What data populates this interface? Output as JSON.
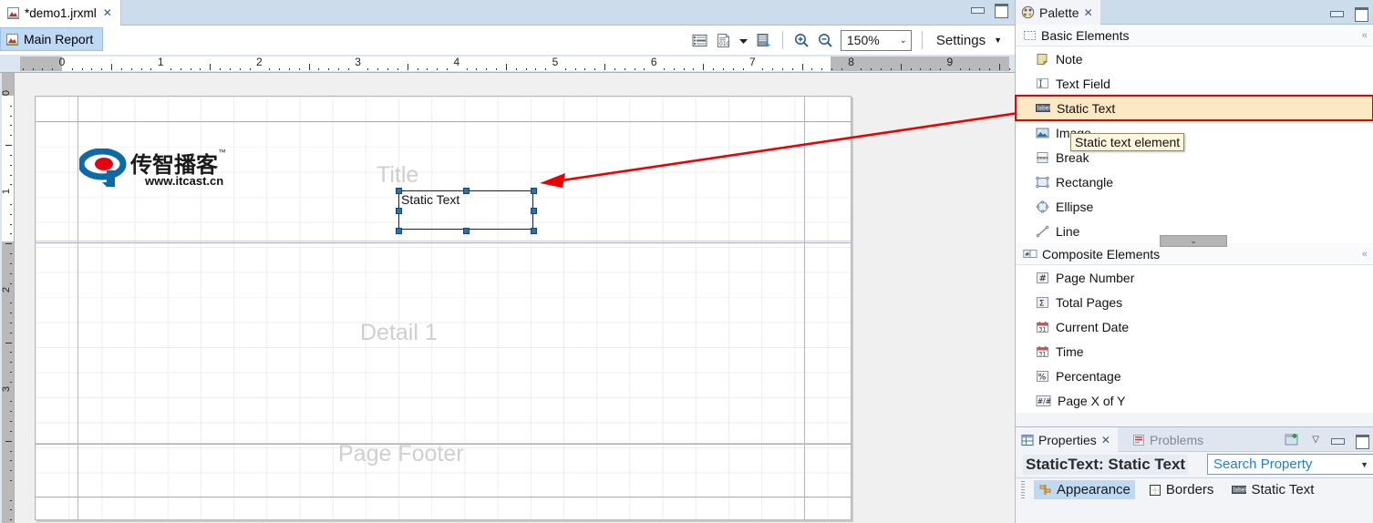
{
  "editor": {
    "tab": {
      "title": "*demo1.jrxml",
      "close": "✕",
      "icon": "jrxml-file-icon"
    },
    "window_buttons": {
      "minimize": "minimize-icon",
      "maximize": "maximize-icon"
    },
    "main_report_tab": "Main Report",
    "toolbar": {
      "icons": [
        "dataset-icon",
        "report-data-icon",
        "dropdown-arrow-icon",
        "preview-icon"
      ],
      "zoom_in": "zoom-in-icon",
      "zoom_out": "zoom-out-icon",
      "zoom_value": "150%",
      "zoom_caret": "⌄",
      "settings_label": "Settings",
      "settings_caret": "▼"
    },
    "ruler": {
      "h_numbers": [
        "0",
        "1",
        "2",
        "3",
        "4",
        "5",
        "6",
        "7",
        "8",
        "9"
      ],
      "v_numbers": [
        "0",
        "1",
        "2",
        "3"
      ]
    },
    "canvas": {
      "bands": [
        "Title",
        "Detail 1",
        "Page Footer"
      ],
      "logo": {
        "chinese": "传智播客",
        "tm": "™",
        "url": "www.itcast.cn",
        "mark_blue": "#0d6aa8",
        "mark_red": "#e60012"
      },
      "selected_element": {
        "label": "Static Text",
        "handles": 8,
        "handle_color": "#2f6fa8"
      },
      "annotation": {
        "type": "arrow",
        "color": "#ee0000"
      }
    }
  },
  "palette": {
    "tab": {
      "label": "Palette",
      "close": "✕",
      "icon": "palette-icon"
    },
    "window_buttons": {
      "minimize": "minimize-icon",
      "maximize": "maximize-icon"
    },
    "groups": [
      {
        "name": "Basic Elements",
        "icon": "basic-elements-icon",
        "collapse": "«",
        "items": [
          {
            "label": "Note",
            "icon": "note-icon",
            "selected": false
          },
          {
            "label": "Text Field",
            "icon": "text-field-icon",
            "selected": false
          },
          {
            "label": "Static Text",
            "icon": "static-text-icon",
            "selected": true
          },
          {
            "label": "Image",
            "icon": "image-icon",
            "selected": false
          },
          {
            "label": "Break",
            "icon": "break-icon",
            "selected": false
          },
          {
            "label": "Rectangle",
            "icon": "rectangle-icon",
            "selected": false
          },
          {
            "label": "Ellipse",
            "icon": "ellipse-icon",
            "selected": false
          },
          {
            "label": "Line",
            "icon": "line-icon",
            "selected": false
          }
        ]
      },
      {
        "name": "Composite Elements",
        "icon": "composite-elements-icon",
        "collapse": "«",
        "items": [
          {
            "label": "Page Number",
            "icon": "page-number-icon",
            "selected": false
          },
          {
            "label": "Total Pages",
            "icon": "total-pages-icon",
            "selected": false
          },
          {
            "label": "Current Date",
            "icon": "calendar-icon",
            "selected": false
          },
          {
            "label": "Time",
            "icon": "calendar-icon",
            "selected": false
          },
          {
            "label": "Percentage",
            "icon": "percentage-icon",
            "selected": false
          },
          {
            "label": "Page X of Y",
            "icon": "page-x-of-y-icon",
            "selected": false
          }
        ]
      }
    ],
    "tooltip": "Static text element",
    "scroll_down": "⌄"
  },
  "properties": {
    "tabs": [
      {
        "label": "Properties",
        "icon": "properties-icon",
        "active": true,
        "close": "✕"
      },
      {
        "label": "Problems",
        "icon": "problems-icon",
        "active": false
      }
    ],
    "tools": {
      "new_icon": "new-view-icon",
      "menu_caret": "▽",
      "minimize": "minimize-icon",
      "maximize": "maximize-icon"
    },
    "object_title": "StaticText: Static Text",
    "search": {
      "placeholder": "Search Property",
      "caret": "▼"
    },
    "sub_tabs": [
      {
        "label": "Appearance",
        "icon": "appearance-icon",
        "active": true
      },
      {
        "label": "Borders",
        "icon": "borders-icon",
        "active": false
      },
      {
        "label": "Static Text",
        "icon": "static-text-icon",
        "active": false
      }
    ]
  }
}
